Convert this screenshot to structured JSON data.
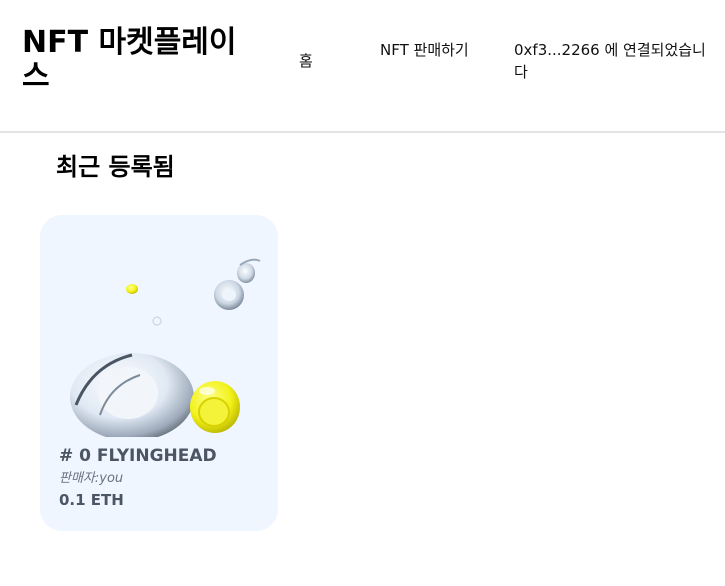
{
  "header": {
    "brand": "NFT 마켓플레이스",
    "nav": {
      "home": "홈",
      "sell": "NFT 판매하기",
      "wallet": "0xf3...2266 에 연결되었습니다"
    }
  },
  "main": {
    "section_title": "최근 등록됨",
    "listings": [
      {
        "name": "# 0 FLYINGHEAD",
        "seller": "판매자:you",
        "price": "0.1 ETH"
      }
    ]
  },
  "colors": {
    "card_background": "#eff6ff",
    "header_border": "#e4e4e7",
    "accent_yellow": "#f2f21a"
  }
}
